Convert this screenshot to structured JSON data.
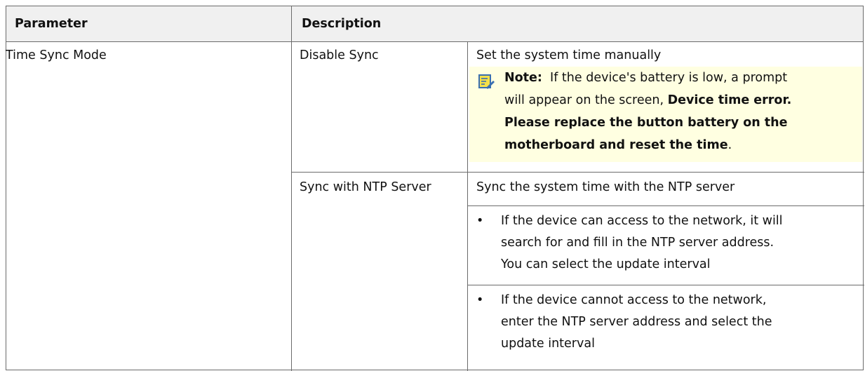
{
  "header": {
    "parameter_label": "Parameter",
    "description_label": "Description"
  },
  "rows": {
    "parameter": "Time Sync Mode",
    "disable": {
      "label": "Disable Sync",
      "description": "Set the system time manually",
      "note": {
        "icon": "note-pencil-icon",
        "heading": "Note:",
        "line1_text": "If the device's battery is low, a prompt",
        "line2_text": "will appear on the screen,",
        "line2_bold": "Device time error.",
        "line3_bold": "Please replace the button battery on the",
        "line4_bold": "motherboard and reset the time",
        "line4_end": "."
      }
    },
    "ntp": {
      "label": "Sync with NTP Server",
      "description": "Sync the system time with the NTP server",
      "bullet_symbol": "•",
      "bullet1": [
        "If the device can access to the network, it will",
        "search for and fill in the NTP server address.",
        "You can select the update interval"
      ],
      "bullet2": [
        "If the device cannot access to the network,",
        "enter the NTP server address and select the",
        "update interval"
      ]
    }
  },
  "colors": {
    "header_bg": "#f0f0f0",
    "note_bg": "#ffffe1",
    "border": "#6b6b6b",
    "icon_accent": "#3a6fb0",
    "icon_fill": "#f5e04a"
  }
}
